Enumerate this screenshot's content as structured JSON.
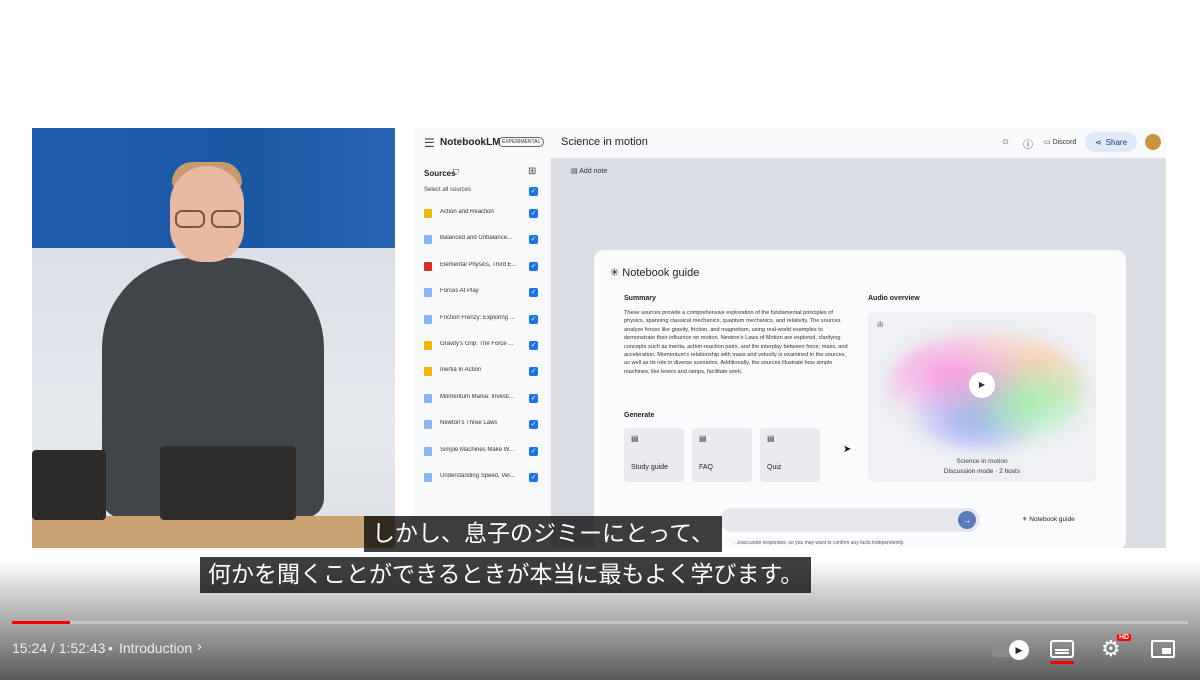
{
  "app": {
    "menu_icon": "hamburger-icon",
    "brand": "NotebookLM",
    "badge": "EXPERIMENTAL",
    "notebook_title": "Science in motion",
    "toolbar": {
      "theme_icon": "sun-icon",
      "help_icon": "help-icon",
      "discord_label": "Discord",
      "share_label": "Share"
    },
    "sidebar": {
      "header": "Sources",
      "select_all": "Select all sources",
      "items": [
        {
          "label": "Action and Reaction",
          "color": "#f2b705"
        },
        {
          "label": "Balanced and Unbalance...",
          "color": "#8ab4f8"
        },
        {
          "label": "Elemental Physics, Third E...",
          "color": "#d93025"
        },
        {
          "label": "Forces At Play",
          "color": "#8ab4f8"
        },
        {
          "label": "Friction Frenzy: Exploring ...",
          "color": "#8ab4f8"
        },
        {
          "label": "Gravity's Grip: The Force ...",
          "color": "#f2b705"
        },
        {
          "label": "Inertia In Action",
          "color": "#f2b705"
        },
        {
          "label": "Momentum Mania: Investi...",
          "color": "#8ab4f8"
        },
        {
          "label": "Newton's Three Laws",
          "color": "#8ab4f8"
        },
        {
          "label": "Simple Machines Make W...",
          "color": "#8ab4f8"
        },
        {
          "label": "Understanding Speed, Vel...",
          "color": "#8ab4f8"
        }
      ]
    },
    "main": {
      "add_note": "Add note",
      "guide_title": "Notebook guide",
      "summary_heading": "Summary",
      "summary_text": "These sources provide a comprehensive exploration of the fundamental principles of physics, spanning classical mechanics, quantum mechanics, and relativity. The sources analyze forces like gravity, friction, and magnetism, using real-world examples to demonstrate their influence on motion. Newton's Laws of Motion are explored, clarifying concepts such as inertia, action-reaction pairs, and the interplay between force, mass, and acceleration. Momentum's relationship with mass and velocity is examined in the sources, as well as its role in diverse scenarios. Additionally, the sources illustrate how simple machines, like levers and ramps, facilitate work.",
      "generate_heading": "Generate",
      "generate_cards": [
        "Study guide",
        "FAQ",
        "Quiz"
      ],
      "audio_heading": "Audio overview",
      "audio_title": "Science in motion",
      "audio_subtitle": "Discussion mode · 2 hosts",
      "notebook_guide_button": "Notebook guide",
      "disclaimer": "...inaccurate responses, so you may want to confirm any facts independently."
    }
  },
  "subtitles": {
    "line1": "しかし、息子のジミーにとって、",
    "line2": "何かを聞くことができるときが本当に最もよく学びます。"
  },
  "player": {
    "time": "15:24 / 1:52:43",
    "chapter_sep": "•",
    "chapter": "Introduction",
    "progress": 0.0494,
    "accent": "#ff0000",
    "hd_badge": "HD"
  }
}
